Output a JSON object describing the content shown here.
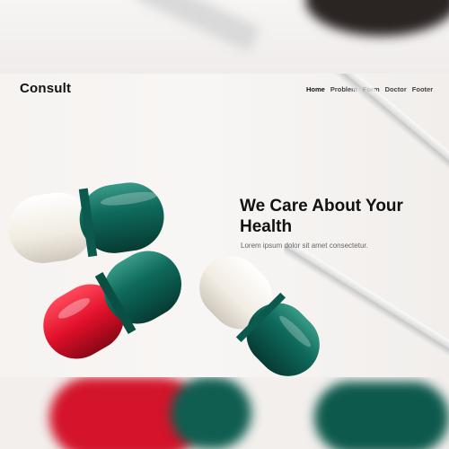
{
  "brand": "Consult",
  "nav": [
    "Home",
    "Problem",
    "Form",
    "Doctor",
    "Footer"
  ],
  "hero": {
    "title": "We Care About Your Health",
    "subtitle": "Lorem ipsum dolor sit amet consectetur."
  },
  "colors": {
    "capsule_green": "#0e6a5b",
    "capsule_red": "#e1102a",
    "capsule_white": "#f5f1e8",
    "text_dark": "#111111"
  }
}
